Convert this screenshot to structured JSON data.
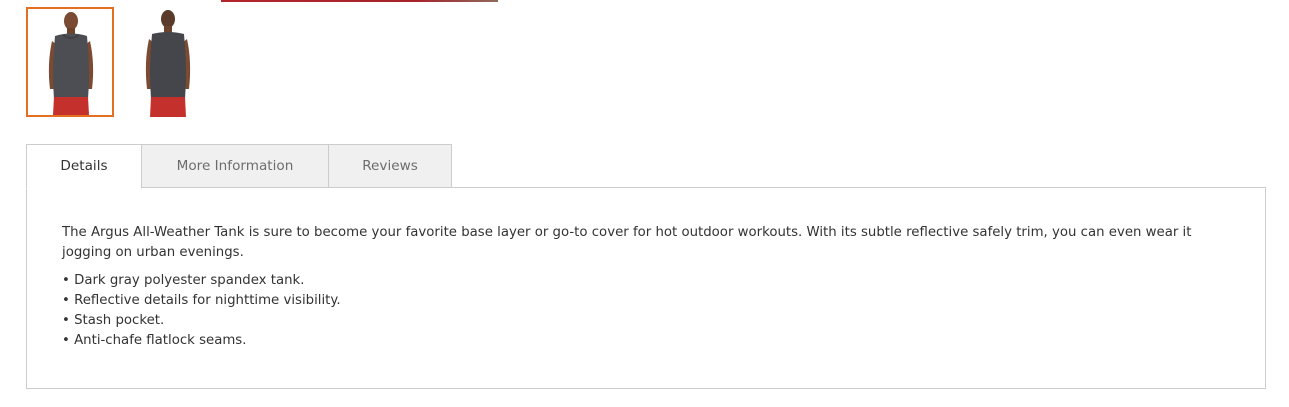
{
  "gallery": {
    "thumbnails": [
      {
        "icon": "product-front-view-image",
        "active": true
      },
      {
        "icon": "product-back-view-image",
        "active": false
      }
    ]
  },
  "tabs": [
    {
      "label": "Details",
      "active": true
    },
    {
      "label": "More Information",
      "active": false
    },
    {
      "label": "Reviews",
      "active": false
    }
  ],
  "details": {
    "description": "The Argus All-Weather Tank is sure to become your favorite base layer or go-to cover for hot outdoor workouts. With its subtle reflective safely trim, you can even wear it jogging on urban evenings.",
    "features": [
      "Dark gray polyester spandex tank.",
      "Reflective details for nighttime visibility.",
      "Stash pocket.",
      "Anti-chafe flatlock seams."
    ]
  },
  "colors": {
    "active_thumb_border": "#e46e22",
    "tab_border": "#cccccc",
    "tab_inactive_bg": "#f0f0f0"
  }
}
